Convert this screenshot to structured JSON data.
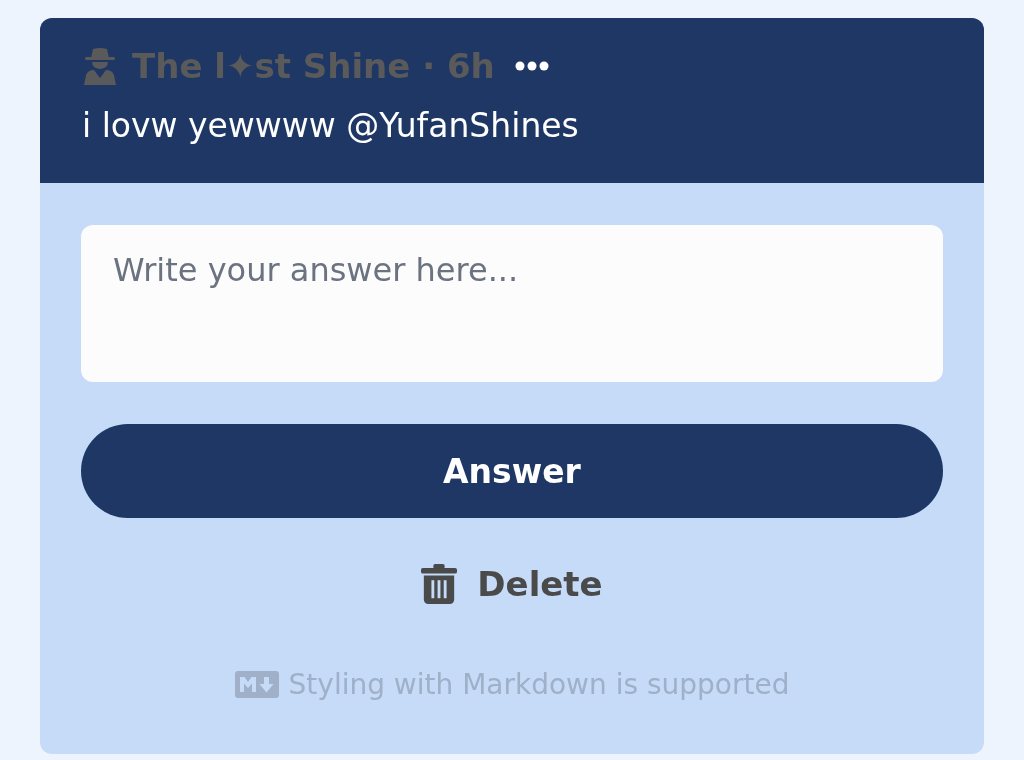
{
  "post": {
    "title": "The l✦st Shine · 6h",
    "message": "i lovw yewwww @YufanShines"
  },
  "answer_field": {
    "placeholder": "Write your answer here..."
  },
  "answer_button": {
    "label": "Answer"
  },
  "delete_button": {
    "label": "Delete"
  },
  "markdown_note": "Styling with Markdown is supported"
}
